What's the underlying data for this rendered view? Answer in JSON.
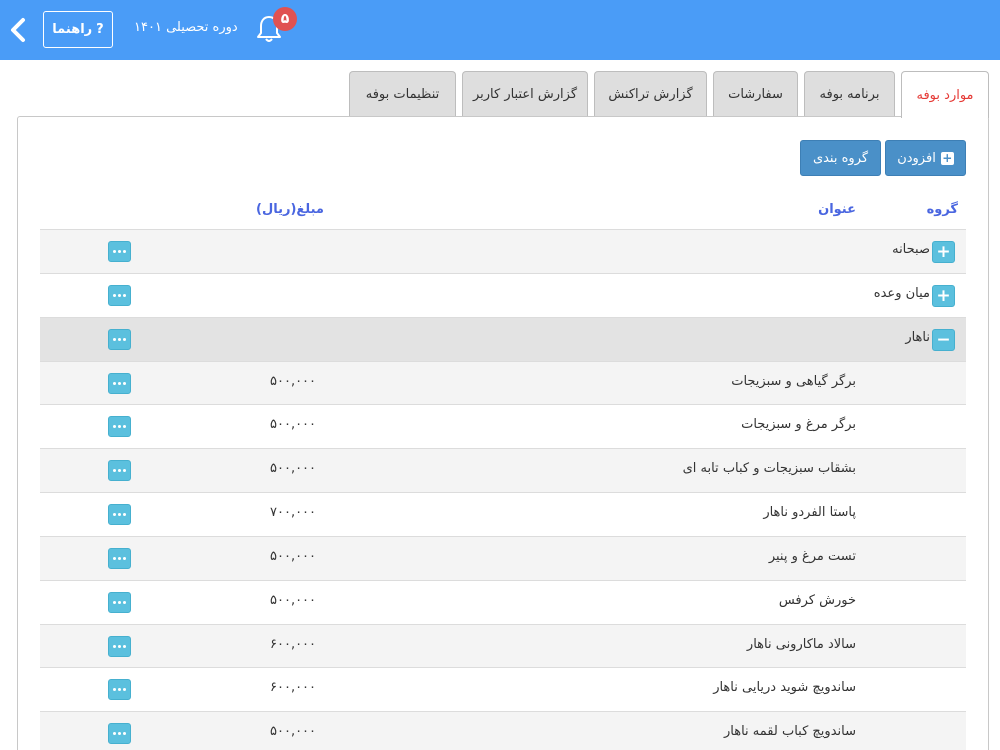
{
  "header": {
    "help_label": "راهنما",
    "help_icon": "?",
    "term_text": "دوره تحصیلی ۱۴۰۱",
    "notification_count": "۵"
  },
  "tabs": [
    {
      "label": "موارد بوفه",
      "active": true
    },
    {
      "label": "برنامه بوفه",
      "active": false
    },
    {
      "label": "سفارشات",
      "active": false
    },
    {
      "label": "گزارش تراکنش",
      "active": false
    },
    {
      "label": "گزارش اعتبار کاربر",
      "active": false
    },
    {
      "label": "تنظیمات بوفه",
      "active": false
    }
  ],
  "toolbar": {
    "add_label": "افزودن",
    "grouping_label": "گروه بندی"
  },
  "table": {
    "headers": {
      "group": "گروه",
      "title": "عنوان",
      "amount": "مبلغ(ریال)"
    },
    "groups": [
      {
        "label": "صبحانه",
        "toggle": "+"
      },
      {
        "label": "میان وعده",
        "toggle": "+"
      },
      {
        "label": "ناهار",
        "toggle": "−"
      }
    ],
    "items": [
      {
        "title": "برگر گیاهی و سبزیجات",
        "price": "۵۰۰,۰۰۰"
      },
      {
        "title": "برگر مرغ و سبزیجات",
        "price": "۵۰۰,۰۰۰"
      },
      {
        "title": "بشقاب سبزیجات و کباب تابه ای",
        "price": "۵۰۰,۰۰۰"
      },
      {
        "title": "پاستا الفردو ناهار",
        "price": "۷۰۰,۰۰۰"
      },
      {
        "title": "تست مرغ و پنیر",
        "price": "۵۰۰,۰۰۰"
      },
      {
        "title": "خورش کرفس",
        "price": "۵۰۰,۰۰۰"
      },
      {
        "title": "سالاد ماکارونی ناهار",
        "price": "۶۰۰,۰۰۰"
      },
      {
        "title": "ساندویچ شوید دریایی ناهار",
        "price": "۶۰۰,۰۰۰"
      },
      {
        "title": "ساندویچ کباب لقمه ناهار",
        "price": "۵۰۰,۰۰۰"
      }
    ]
  },
  "colors": {
    "header_bg": "#4a9cf7",
    "active_tab_text": "#e53935",
    "button_primary": "#4a90c8",
    "action_button": "#5bc0de",
    "header_text": "#4a66e0",
    "badge": "#e05252"
  }
}
